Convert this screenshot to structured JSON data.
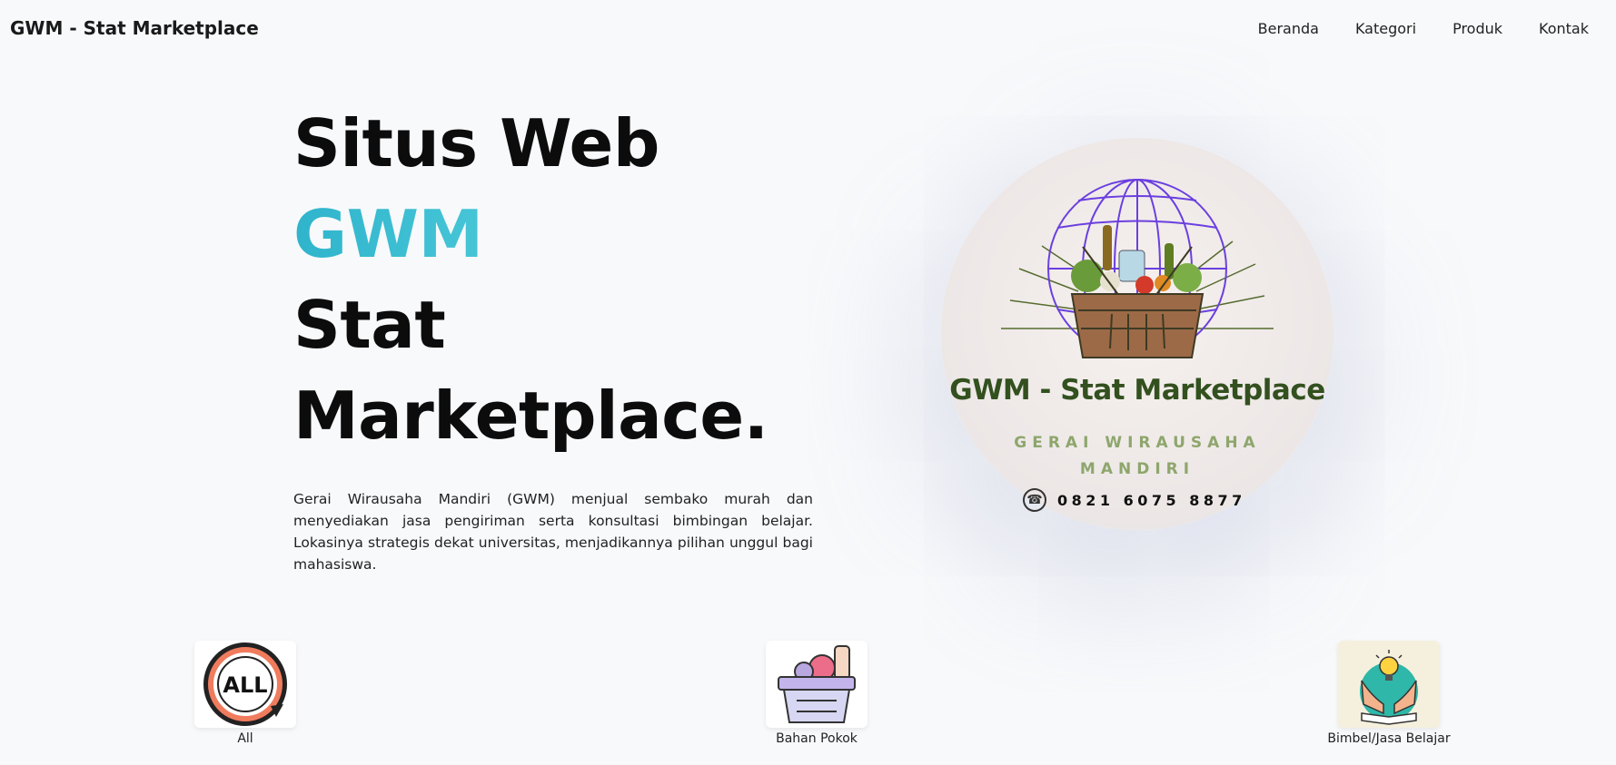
{
  "navbar": {
    "brand": "GWM - Stat Marketplace",
    "links": [
      "Beranda",
      "Kategori",
      "Produk",
      "Kontak"
    ]
  },
  "hero": {
    "title_line1": "Situs Web",
    "title_accent": "GWM",
    "title_line3": "Stat",
    "title_line4": "Marketplace.",
    "description": "Gerai Wirausaha Mandiri (GWM) menjual sembako murah dan menyediakan jasa pengiriman serta konsultasi bimbingan belajar. Lokasinya strategis dekat universitas, menjadikannya pilihan unggul bagi mahasiswa."
  },
  "logo": {
    "title": "GWM - Stat Marketplace",
    "subtitle_line1": "GERAI WIRAUSAHA",
    "subtitle_line2": "MANDIRI",
    "phone": "0821 6075 8877",
    "icon": "grocery-basket-globe-icon"
  },
  "categories": [
    {
      "label": "All",
      "icon": "all-refresh-icon"
    },
    {
      "label": "Bahan Pokok",
      "icon": "grocery-basket-icon"
    },
    {
      "label": "Bimbel/Jasa Belajar",
      "icon": "learning-idea-icon"
    }
  ],
  "colors": {
    "accent_start": "#2fb4cc",
    "accent_end": "#6fe3ea",
    "logo_green": "#33501f",
    "logo_sub": "#8ea66c",
    "globe_purple": "#6b3fe0"
  }
}
